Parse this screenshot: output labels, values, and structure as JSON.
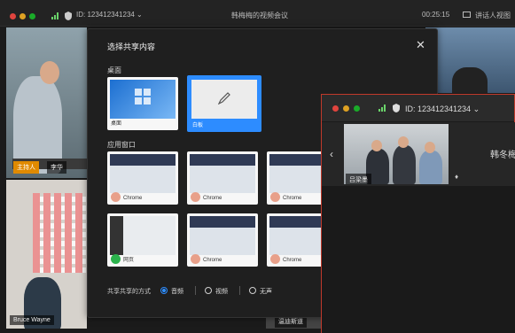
{
  "topbar": {
    "meeting_id": "ID: 123412341234 ⌄",
    "meeting_title": "韩梅梅的视频会议",
    "timer": "00:25:15",
    "view_button": "讲话人视图"
  },
  "participants": {
    "bottom_left_name": "Bruce Wayne",
    "tile_name_right": "温迪斯道",
    "tag_host": "主持人",
    "tag_name": "李华"
  },
  "dialog": {
    "title": "选择共享内容",
    "section_desktop": "桌面",
    "section_windows": "应用窗口",
    "desktop_items": [
      {
        "label": "桌面"
      },
      {
        "label": "白板"
      }
    ],
    "window_items": [
      {
        "label": "Chrome"
      },
      {
        "label": "Chrome"
      },
      {
        "label": "Chrome"
      },
      {
        "label": "网页"
      },
      {
        "label": "Chrome"
      },
      {
        "label": "Chrome"
      }
    ],
    "audio_label": "共享共享的方式",
    "audio_options": [
      {
        "label": "音频",
        "selected": true
      },
      {
        "label": "视频",
        "selected": false
      },
      {
        "label": "无声",
        "selected": false
      }
    ]
  },
  "float_window": {
    "meeting_id": "ID: 123412341234 ⌄",
    "participant_name": "吕梁墨",
    "side_name": "韩冬梅"
  },
  "colors": {
    "accent": "#2d8cff",
    "record_red": "#e53935",
    "dialog_bg": "#1f1f1f"
  }
}
